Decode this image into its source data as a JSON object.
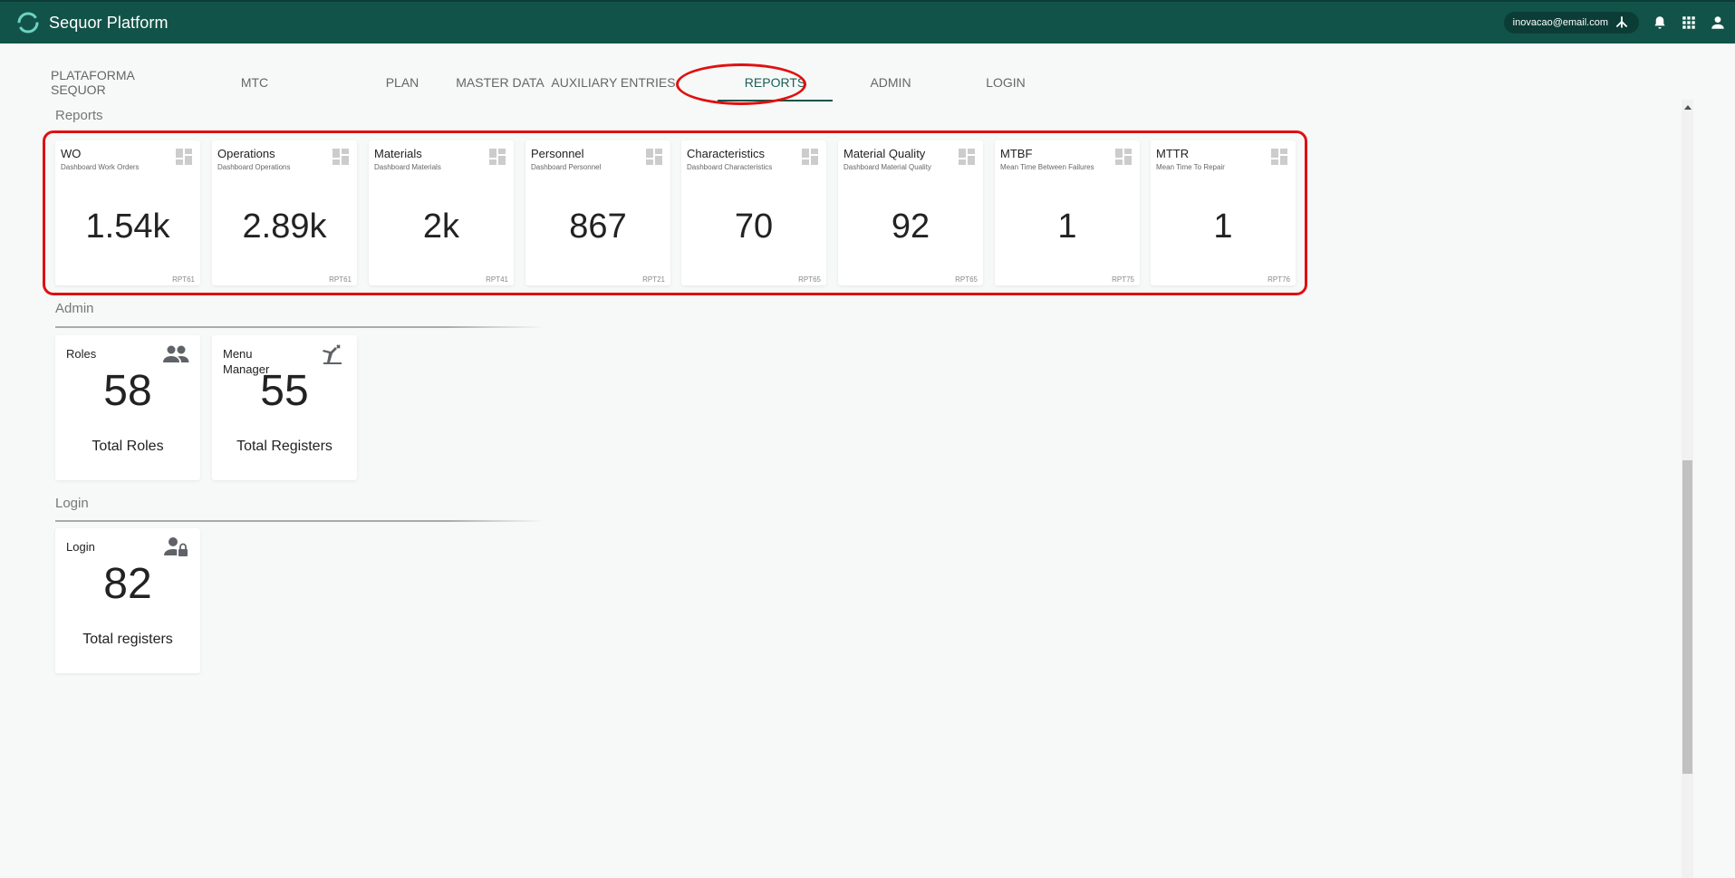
{
  "header": {
    "title": "Sequor Platform",
    "user_email": "inovacao@email.com",
    "brand_color": "#125349",
    "icons": [
      "sitemap-icon",
      "bell-icon",
      "apps-grid-icon",
      "user-icon"
    ]
  },
  "tabs": [
    {
      "label": "PLATAFORMA SEQUOR"
    },
    {
      "label": "MTC"
    },
    {
      "label": "PLAN"
    },
    {
      "label": "MASTER DATA"
    },
    {
      "label": "AUXILIARY ENTRIES"
    },
    {
      "label": "REPORTS",
      "active": true
    },
    {
      "label": "ADMIN"
    },
    {
      "label": "LOGIN"
    }
  ],
  "reports": {
    "section_label": "Reports",
    "cards": [
      {
        "title": "WO",
        "subtitle": "Dashboard Work Orders",
        "value": "1.54k",
        "code": "RPT61",
        "icon": "dashboard-icon"
      },
      {
        "title": "Operations",
        "subtitle": "Dashboard Operations",
        "value": "2.89k",
        "code": "RPT61",
        "icon": "dashboard-icon"
      },
      {
        "title": "Materials",
        "subtitle": "Dashboard Materials",
        "value": "2k",
        "code": "RPT41",
        "icon": "dashboard-icon"
      },
      {
        "title": "Personnel",
        "subtitle": "Dashboard Personnel",
        "value": "867",
        "code": "RPT21",
        "icon": "dashboard-icon"
      },
      {
        "title": "Characteristics",
        "subtitle": "Dashboard Characteristics",
        "value": "70",
        "code": "RPT65",
        "icon": "dashboard-icon"
      },
      {
        "title": "Material Quality",
        "subtitle": "Dashboard Material Quality",
        "value": "92",
        "code": "RPT65",
        "icon": "dashboard-icon"
      },
      {
        "title": "MTBF",
        "subtitle": "Mean Time Between Failures",
        "value": "1",
        "code": "RPT75",
        "icon": "dashboard-icon"
      },
      {
        "title": "MTTR",
        "subtitle": "Mean Time To Repair",
        "value": "1",
        "code": "RPT76",
        "icon": "dashboard-icon"
      }
    ]
  },
  "admin": {
    "section_label": "Admin",
    "cards": [
      {
        "title": "Roles",
        "value": "58",
        "footer": "Total Roles",
        "icon": "people-icon"
      },
      {
        "title": "Menu Manager",
        "value": "55",
        "footer": "Total Registers",
        "icon": "menu-manager-icon"
      }
    ]
  },
  "login": {
    "section_label": "Login",
    "cards": [
      {
        "title": "Login",
        "value": "82",
        "footer": "Total registers",
        "icon": "user-lock-icon"
      }
    ]
  }
}
